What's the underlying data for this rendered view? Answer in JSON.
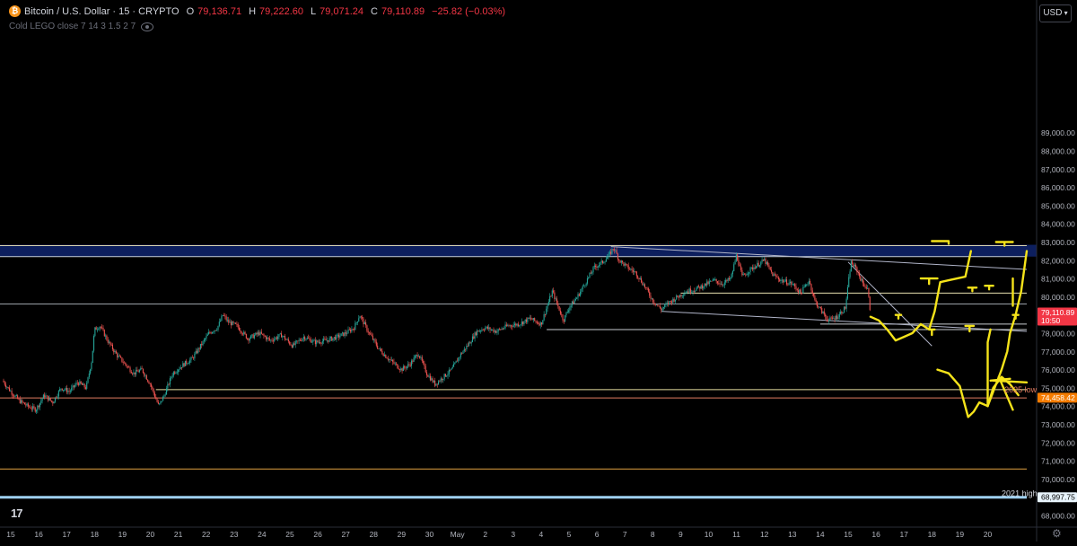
{
  "header": {
    "symbol": "Bitcoin / U.S. Dollar · 15 · CRYPTO",
    "coin_glyph": "₿",
    "open_label": "O",
    "open": "79,136.71",
    "high_label": "H",
    "high": "79,222.60",
    "low_label": "L",
    "low": "79,071.24",
    "close_label": "C",
    "close": "79,110.89",
    "change": "−25.82 (−0.03%)"
  },
  "indicator": {
    "label": "Cold LEGO close 7 14 3 1.5 2 7",
    "icon": "eye-icon"
  },
  "currency": "USD",
  "logo": "17",
  "settings_icon": "gear-icon",
  "colors": {
    "background": "#000000",
    "up": "#26a69a",
    "down": "#ef5350",
    "band": "#0d1f5e",
    "annotation": "#f5e31a"
  },
  "chart_data": {
    "type": "candlestick",
    "ylim": [
      67500,
      90000
    ],
    "x_ticks": [
      {
        "label": "15",
        "t": 0
      },
      {
        "label": "16",
        "t": 1
      },
      {
        "label": "17",
        "t": 2
      },
      {
        "label": "18",
        "t": 3
      },
      {
        "label": "19",
        "t": 4
      },
      {
        "label": "20",
        "t": 5
      },
      {
        "label": "21",
        "t": 6
      },
      {
        "label": "22",
        "t": 7
      },
      {
        "label": "23",
        "t": 8
      },
      {
        "label": "24",
        "t": 9
      },
      {
        "label": "25",
        "t": 10
      },
      {
        "label": "26",
        "t": 11
      },
      {
        "label": "27",
        "t": 12
      },
      {
        "label": "28",
        "t": 13
      },
      {
        "label": "29",
        "t": 14
      },
      {
        "label": "30",
        "t": 15
      },
      {
        "label": "May",
        "t": 16
      },
      {
        "label": "2",
        "t": 17
      },
      {
        "label": "3",
        "t": 18
      },
      {
        "label": "4",
        "t": 19
      },
      {
        "label": "5",
        "t": 20
      },
      {
        "label": "6",
        "t": 21
      },
      {
        "label": "7",
        "t": 22
      },
      {
        "label": "8",
        "t": 23
      },
      {
        "label": "9",
        "t": 24
      },
      {
        "label": "10",
        "t": 25
      },
      {
        "label": "11",
        "t": 26
      },
      {
        "label": "12",
        "t": 27
      },
      {
        "label": "13",
        "t": 28
      },
      {
        "label": "14",
        "t": 29
      },
      {
        "label": "15",
        "t": 30
      },
      {
        "label": "16",
        "t": 31
      },
      {
        "label": "17",
        "t": 32
      },
      {
        "label": "18",
        "t": 33
      },
      {
        "label": "19",
        "t": 34
      },
      {
        "label": "20",
        "t": 35
      }
    ],
    "y_ticks": [
      "89,000.00",
      "88,000.00",
      "87,000.00",
      "86,000.00",
      "85,000.00",
      "84,000.00",
      "83,000.00",
      "82,000.00",
      "81,000.00",
      "80,000.00",
      "79,000.00",
      "78,000.00",
      "77,000.00",
      "76,000.00",
      "75,000.00",
      "74,000.00",
      "73,000.00",
      "72,000.00",
      "71,000.00",
      "70,000.00",
      "69,000.00",
      "68,000.00"
    ],
    "price_path": [
      [
        -0.3,
        75400
      ],
      [
        0,
        74800
      ],
      [
        0.3,
        74300
      ],
      [
        0.6,
        74000
      ],
      [
        0.9,
        73800
      ],
      [
        1.2,
        74600
      ],
      [
        1.5,
        74200
      ],
      [
        1.8,
        75000
      ],
      [
        2.1,
        74800
      ],
      [
        2.4,
        75300
      ],
      [
        2.7,
        75000
      ],
      [
        2.9,
        76500
      ],
      [
        3.0,
        78200
      ],
      [
        3.2,
        78400
      ],
      [
        3.5,
        77500
      ],
      [
        3.8,
        76800
      ],
      [
        4.1,
        76300
      ],
      [
        4.4,
        75800
      ],
      [
        4.7,
        76000
      ],
      [
        5.0,
        75200
      ],
      [
        5.3,
        74000
      ],
      [
        5.5,
        74600
      ],
      [
        5.8,
        75800
      ],
      [
        6.2,
        76300
      ],
      [
        6.5,
        76600
      ],
      [
        6.8,
        77300
      ],
      [
        7.1,
        78000
      ],
      [
        7.4,
        78300
      ],
      [
        7.6,
        79000
      ],
      [
        7.8,
        78600
      ],
      [
        8.1,
        78400
      ],
      [
        8.5,
        77700
      ],
      [
        8.9,
        78000
      ],
      [
        9.3,
        77600
      ],
      [
        9.7,
        77900
      ],
      [
        10.1,
        77300
      ],
      [
        10.5,
        77800
      ],
      [
        10.9,
        77500
      ],
      [
        11.3,
        77600
      ],
      [
        11.7,
        77800
      ],
      [
        12.0,
        78000
      ],
      [
        12.3,
        78300
      ],
      [
        12.5,
        79000
      ],
      [
        12.8,
        78100
      ],
      [
        13.2,
        77100
      ],
      [
        13.6,
        76500
      ],
      [
        14.0,
        76000
      ],
      [
        14.3,
        76300
      ],
      [
        14.6,
        76900
      ],
      [
        14.9,
        75800
      ],
      [
        15.2,
        75200
      ],
      [
        15.5,
        75600
      ],
      [
        15.8,
        76000
      ],
      [
        16.1,
        76800
      ],
      [
        16.4,
        77400
      ],
      [
        16.7,
        78100
      ],
      [
        17.0,
        78300
      ],
      [
        17.4,
        78100
      ],
      [
        17.8,
        78400
      ],
      [
        18.2,
        78500
      ],
      [
        18.6,
        78800
      ],
      [
        19.0,
        78500
      ],
      [
        19.2,
        79400
      ],
      [
        19.4,
        80300
      ],
      [
        19.6,
        79500
      ],
      [
        19.8,
        78700
      ],
      [
        20.0,
        79400
      ],
      [
        20.3,
        80000
      ],
      [
        20.6,
        80800
      ],
      [
        20.9,
        81600
      ],
      [
        21.2,
        81900
      ],
      [
        21.4,
        82200
      ],
      [
        21.6,
        82700
      ],
      [
        21.8,
        82000
      ],
      [
        22.1,
        81600
      ],
      [
        22.4,
        81300
      ],
      [
        22.7,
        80600
      ],
      [
        23.0,
        79800
      ],
      [
        23.3,
        79300
      ],
      [
        23.6,
        79700
      ],
      [
        23.9,
        80000
      ],
      [
        24.2,
        80300
      ],
      [
        24.5,
        80400
      ],
      [
        24.8,
        80600
      ],
      [
        25.2,
        80900
      ],
      [
        25.5,
        80700
      ],
      [
        25.8,
        81000
      ],
      [
        26.0,
        82300
      ],
      [
        26.2,
        81100
      ],
      [
        26.5,
        81500
      ],
      [
        26.8,
        81800
      ],
      [
        27.0,
        82000
      ],
      [
        27.3,
        81200
      ],
      [
        27.6,
        80900
      ],
      [
        28.0,
        80700
      ],
      [
        28.3,
        80200
      ],
      [
        28.6,
        80900
      ],
      [
        28.8,
        79800
      ],
      [
        29.0,
        79300
      ],
      [
        29.3,
        78700
      ],
      [
        29.6,
        78900
      ],
      [
        29.9,
        79400
      ],
      [
        30.1,
        81900
      ],
      [
        30.3,
        81500
      ],
      [
        30.5,
        80800
      ],
      [
        30.7,
        80400
      ],
      [
        30.8,
        79100
      ]
    ],
    "horizontal_levels": [
      {
        "price": 82800,
        "color": "#d9d4b0",
        "t0": -0.5,
        "t1": 36.4
      },
      {
        "price": 82200,
        "color": "#c8d0d8",
        "t0": -0.5,
        "t1": 36.4
      },
      {
        "price": 79600,
        "color": "#9aa0a6",
        "t0": -0.5,
        "t1": 36.4
      },
      {
        "price": 80200,
        "color": "#e8e1b0",
        "t0": 24.0,
        "t1": 36.4
      },
      {
        "price": 78500,
        "color": "#c8ccd0",
        "t0": 29.0,
        "t1": 36.4
      },
      {
        "price": 74900,
        "color": "#e8e0a0",
        "t0": 5.2,
        "t1": 36.4
      },
      {
        "price": 74450,
        "color": "#e07a5f",
        "t0": -0.5,
        "t1": 36.4
      },
      {
        "price": 70550,
        "color": "#e0a040",
        "t0": -0.5,
        "t1": 36.4
      },
      {
        "price": 69000,
        "color": "#9ed0f0",
        "t0": -0.5,
        "t1": 36.4,
        "thick": true
      }
    ],
    "trendlines": [
      {
        "from": [
          21.5,
          82750
        ],
        "to": [
          36.4,
          81500
        ],
        "color": "#b0b4c8"
      },
      {
        "from": [
          23.3,
          79200
        ],
        "to": [
          36.4,
          78100
        ],
        "color": "#b0b4c8"
      },
      {
        "from": [
          19.2,
          78200
        ],
        "to": [
          36.4,
          78200
        ],
        "color": "#c8ccd0"
      },
      {
        "from": [
          30.0,
          81900
        ],
        "to": [
          33.0,
          77300
        ],
        "color": "#b0b4c8"
      }
    ],
    "zones": [
      {
        "price_top": 82850,
        "price_bottom": 82200,
        "color": "#0d1f5e"
      }
    ],
    "annotations": [
      {
        "text": "2025 low",
        "t": 35.6,
        "price": 74900,
        "color": "#e07a5f"
      },
      {
        "text": "2021 high",
        "t": 35.5,
        "price": 69200,
        "color": "#d1d4dc"
      }
    ],
    "price_labels": [
      {
        "text": "79,110.89",
        "sub": "10:50",
        "price": 79110.89,
        "color": "#f23645"
      },
      {
        "text": "74,458.42",
        "price": 74458.42,
        "color": "#f57c00"
      },
      {
        "text": "68,997.75",
        "price": 68997.75,
        "color": "#e8f4fc",
        "text_color": "#000"
      }
    ],
    "drawings": [
      [
        [
          30.8,
          78900
        ],
        [
          31.1,
          78700
        ],
        [
          31.4,
          78200
        ],
        [
          31.7,
          77600
        ],
        [
          32.0,
          77800
        ],
        [
          32.3,
          78000
        ],
        [
          32.6,
          78500
        ],
        [
          32.9,
          78200
        ],
        [
          33.1,
          79200
        ],
        [
          33.3,
          80800
        ],
        [
          33.6,
          80900
        ],
        [
          33.9,
          81000
        ],
        [
          34.2,
          81100
        ],
        [
          34.4,
          82500
        ]
      ],
      [
        [
          33.0,
          83050
        ],
        [
          33.6,
          83050
        ],
        [
          33.6,
          82900
        ]
      ],
      [
        [
          35.3,
          83000
        ],
        [
          35.9,
          83000
        ],
        [
          35.6,
          83000
        ],
        [
          35.6,
          82800
        ]
      ],
      [
        [
          32.6,
          81000
        ],
        [
          33.2,
          81000
        ],
        [
          32.9,
          81000
        ],
        [
          32.9,
          80700
        ]
      ],
      [
        [
          34.3,
          80500
        ],
        [
          34.6,
          80500
        ],
        [
          34.45,
          80500
        ],
        [
          34.45,
          80300
        ]
      ],
      [
        [
          34.9,
          80600
        ],
        [
          35.2,
          80600
        ],
        [
          35.05,
          80600
        ],
        [
          35.05,
          80400
        ]
      ],
      [
        [
          31.7,
          79000
        ],
        [
          31.9,
          79000
        ],
        [
          31.8,
          79000
        ],
        [
          31.8,
          78800
        ]
      ],
      [
        [
          32.9,
          78200
        ],
        [
          33.1,
          78200
        ],
        [
          33.0,
          78200
        ],
        [
          33.0,
          77900
        ]
      ],
      [
        [
          34.2,
          78400
        ],
        [
          34.5,
          78400
        ],
        [
          34.35,
          78400
        ],
        [
          34.35,
          78100
        ]
      ],
      [
        [
          35.9,
          79000
        ],
        [
          36.1,
          79000
        ],
        [
          36.0,
          79000
        ],
        [
          36.0,
          78800
        ]
      ],
      [
        [
          35.0,
          74000
        ],
        [
          35.3,
          75200
        ],
        [
          35.5,
          76000
        ],
        [
          35.7,
          77000
        ],
        [
          35.8,
          78000
        ],
        [
          35.9,
          78500
        ],
        [
          36.0,
          79000
        ],
        [
          36.2,
          80300
        ],
        [
          36.4,
          82500
        ]
      ],
      [
        [
          35.0,
          74000
        ],
        [
          35.0,
          77500
        ],
        [
          35.1,
          78200
        ]
      ],
      [
        [
          35.9,
          79500
        ],
        [
          35.9,
          81000
        ]
      ],
      [
        [
          33.2,
          76000
        ],
        [
          33.6,
          75800
        ],
        [
          34.0,
          75100
        ],
        [
          34.3,
          73400
        ],
        [
          34.5,
          73700
        ],
        [
          34.7,
          74200
        ],
        [
          35.0,
          74000
        ],
        [
          35.2,
          75000
        ],
        [
          35.5,
          75600
        ],
        [
          35.8,
          75200
        ],
        [
          36.1,
          74600
        ]
      ],
      [
        [
          35.2,
          75400
        ],
        [
          36.4,
          75300
        ]
      ],
      [
        [
          35.4,
          75600
        ],
        [
          35.9,
          73800
        ]
      ],
      [
        [
          35.1,
          75400
        ],
        [
          35.8,
          75500
        ]
      ]
    ]
  }
}
